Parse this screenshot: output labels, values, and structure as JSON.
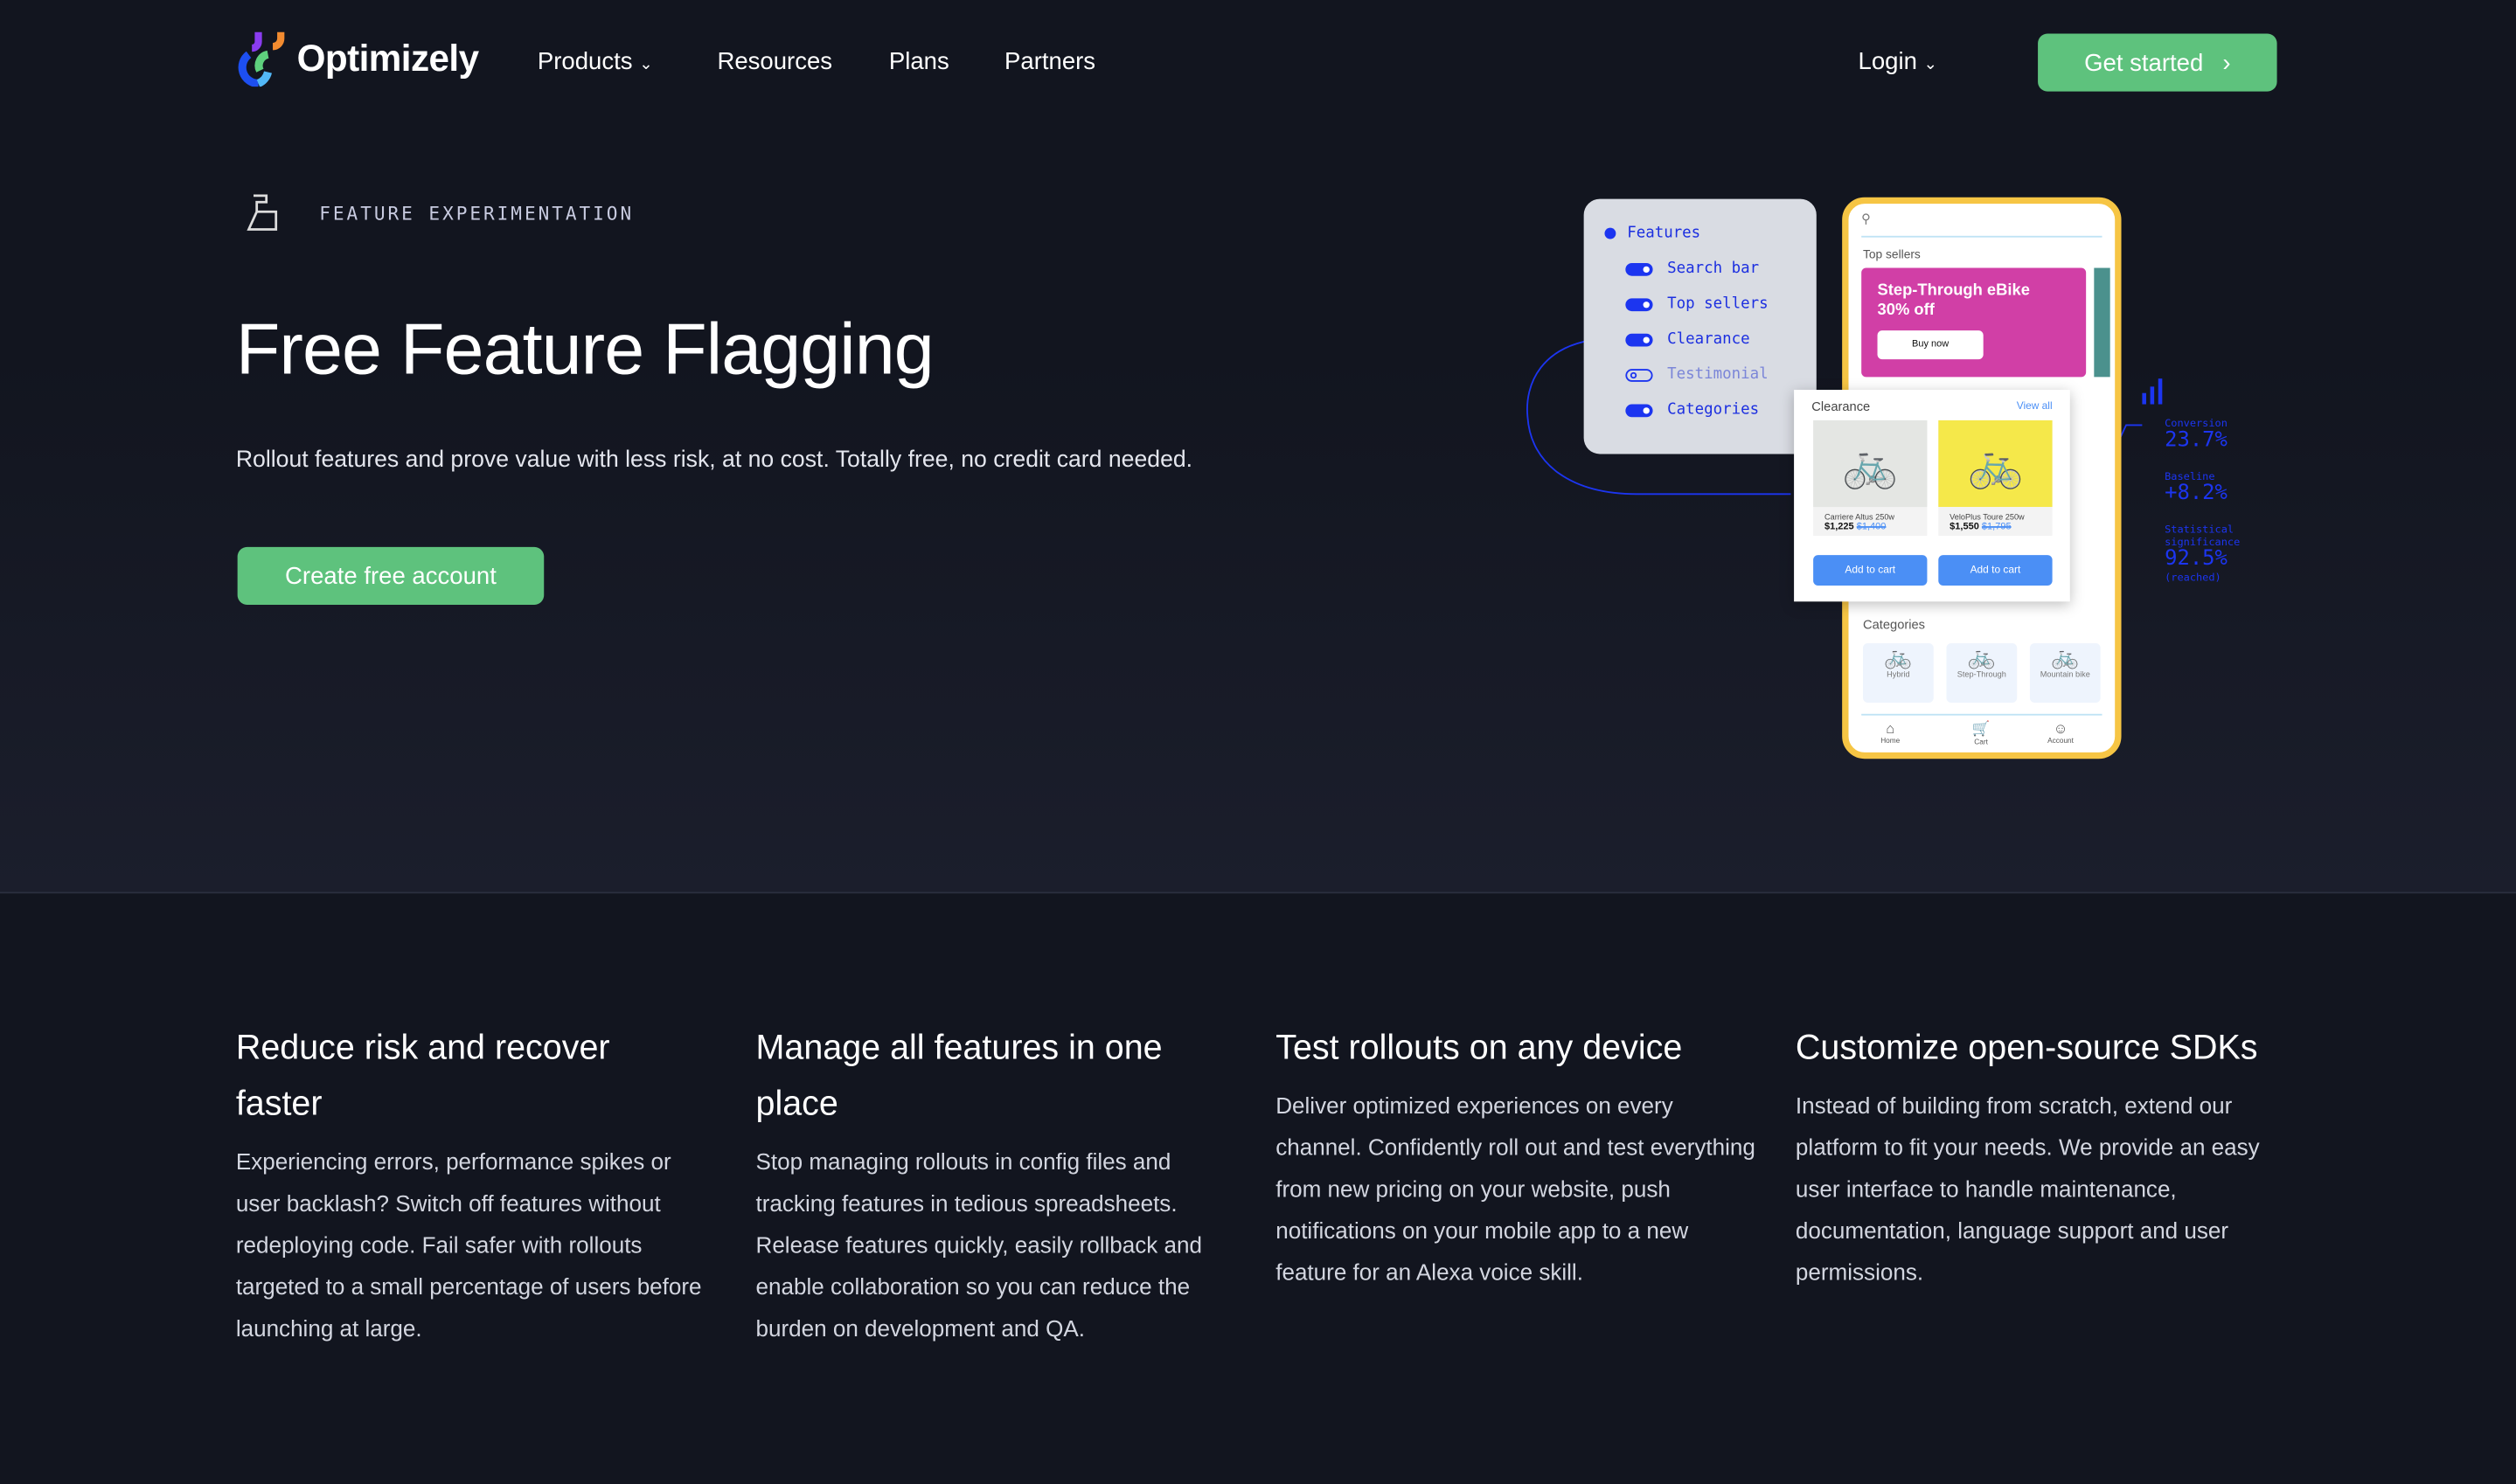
{
  "nav": {
    "brand": "Optimizely",
    "items": [
      "Products",
      "Resources",
      "Plans",
      "Partners"
    ],
    "login": "Login",
    "cta": "Get started"
  },
  "hero": {
    "eyebrow": "FEATURE EXPERIMENTATION",
    "title": "Free Feature Flagging",
    "subtitle": "Rollout features and prove value with less risk, at no cost. Totally free, no credit card needed.",
    "cta": "Create free account"
  },
  "illustration": {
    "panel": {
      "title": "Features",
      "flags": [
        {
          "label": "Search bar",
          "on": true
        },
        {
          "label": "Top sellers",
          "on": true
        },
        {
          "label": "Clearance",
          "on": true
        },
        {
          "label": "Testimonial",
          "on": false
        },
        {
          "label": "Categories",
          "on": true
        }
      ]
    },
    "phone": {
      "top_sellers": "Top sellers",
      "promo_title": "Step-Through eBike",
      "promo_sub": "30% off",
      "promo_button": "Buy now",
      "categories_title": "Categories",
      "categories": [
        "Hybrid",
        "Step-Through",
        "Mountain bike"
      ],
      "tabs": [
        "Home",
        "Cart",
        "Account"
      ]
    },
    "clearance": {
      "title": "Clearance",
      "view_all": "View all",
      "products": [
        {
          "name": "Carriere Altus 250w",
          "price": "$1,225",
          "old_price": "$1,400",
          "button": "Add to cart"
        },
        {
          "name": "VeloPlus Toure 250w",
          "price": "$1,550",
          "old_price": "$1,795",
          "button": "Add to cart"
        }
      ]
    },
    "stats": [
      {
        "label": "Conversion",
        "value": "23.7%"
      },
      {
        "label": "Baseline",
        "value": "+8.2%"
      },
      {
        "label": "Statistical significance",
        "value": "92.5%",
        "note": "(reached)"
      }
    ]
  },
  "features": [
    {
      "title": "Reduce risk and recover faster",
      "body": "Experiencing errors, performance spikes or user backlash? Switch off features without redeploying code. Fail safer with rollouts targeted to a small percentage of users before launching at large."
    },
    {
      "title": "Manage all features in one place",
      "body": "Stop managing rollouts in config files and tracking features in tedious spreadsheets. Release features quickly, easily rollback and enable collaboration so you can reduce the burden on development and QA."
    },
    {
      "title": "Test rollouts on any device",
      "body": "Deliver optimized experiences on every channel. Confidently roll out and test everything from new pricing on your website, push notifications on your mobile app to a new feature for an Alexa voice skill."
    },
    {
      "title": "Customize open-source SDKs",
      "body": "Instead of building from scratch, extend our platform to fit your needs. We provide an easy user interface to handle maintenance, documentation, language support and user permissions."
    }
  ],
  "colors": {
    "background": "#12151f",
    "accent_green": "#5ec27d",
    "flag_blue": "#1c35f0",
    "phone_frame": "#f6c544"
  }
}
